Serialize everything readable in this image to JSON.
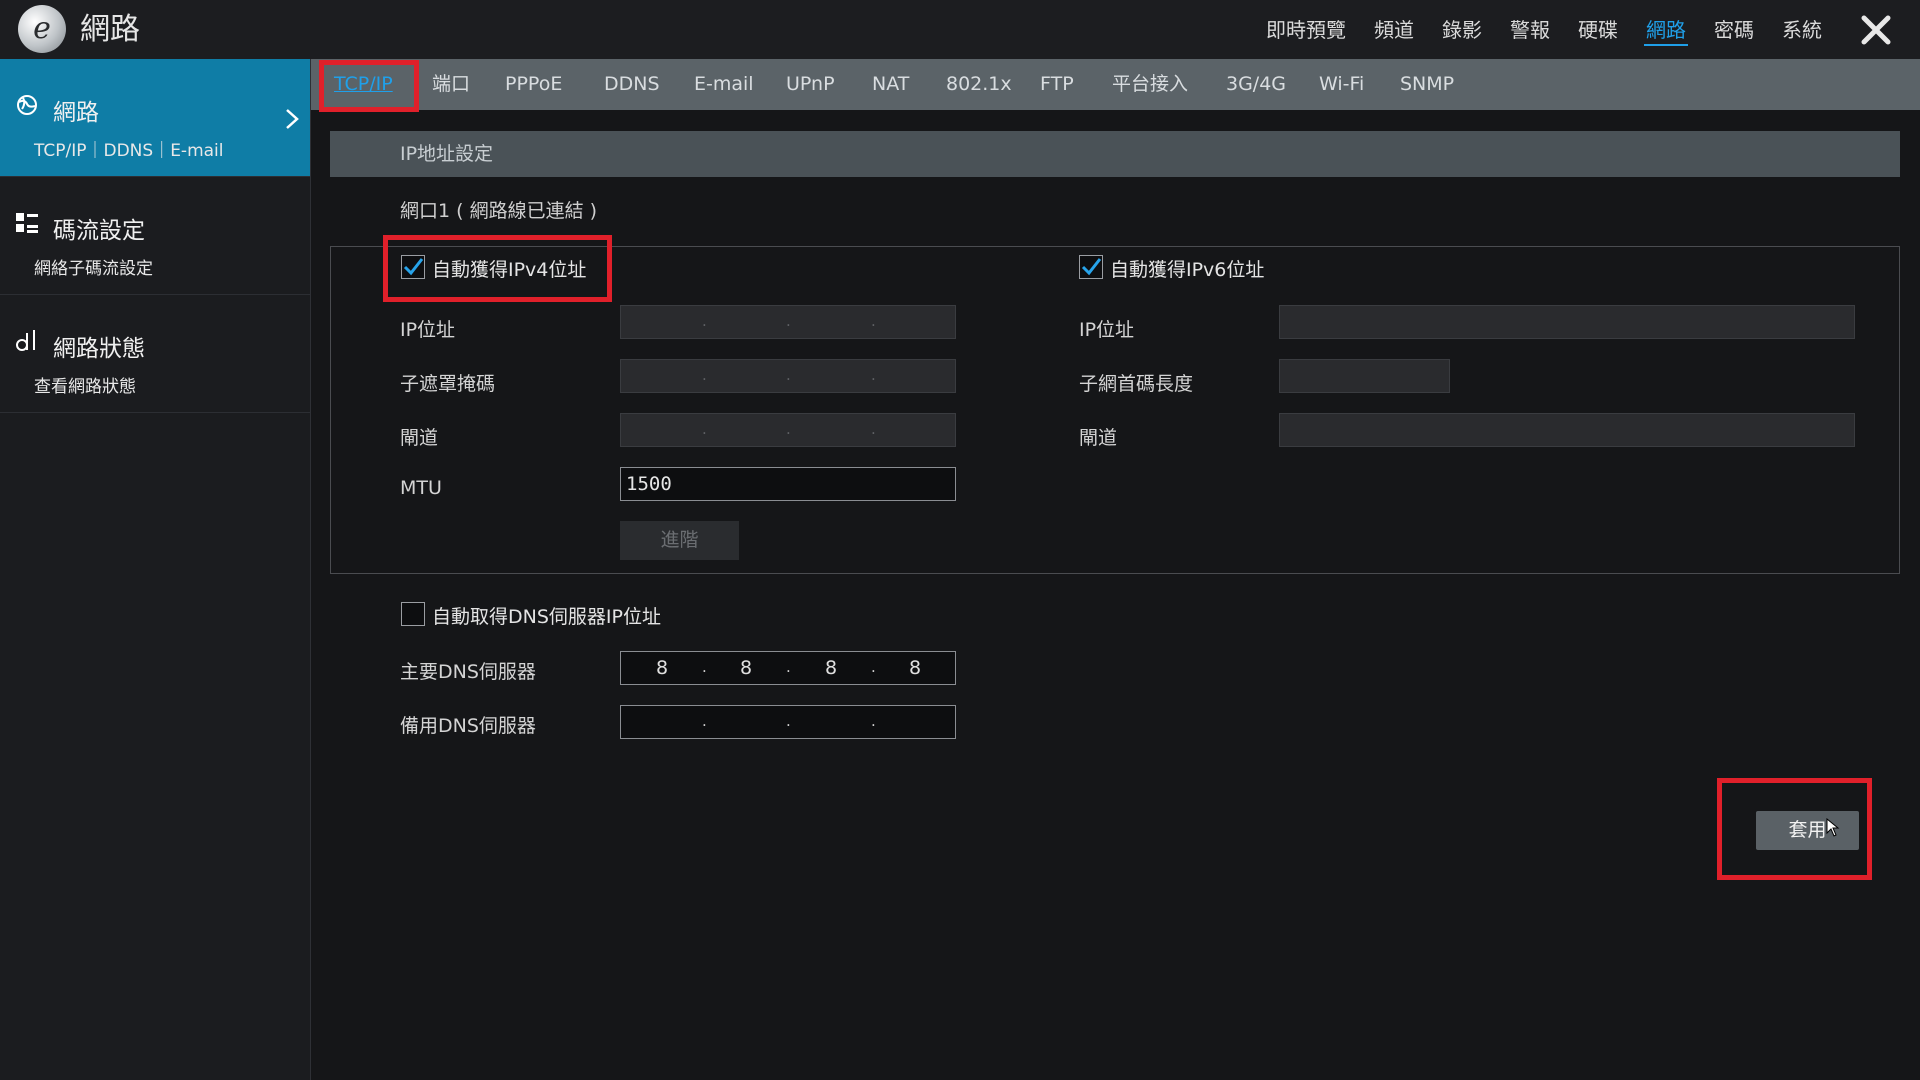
{
  "app": {
    "title": "網路",
    "logo_letter": "e",
    "close_icon": "close-icon"
  },
  "top_nav": {
    "items": [
      "即時預覽",
      "頻道",
      "錄影",
      "警報",
      "硬碟",
      "網路",
      "密碼",
      "系統"
    ],
    "active": "網路"
  },
  "sidebar": {
    "items": [
      {
        "title": "網路",
        "subtitle": "TCP/IP｜DDNS｜E-mail",
        "icon": "globe-icon",
        "active": true
      },
      {
        "title": "碼流設定",
        "subtitle": "網絡子碼流設定",
        "icon": "grid-icon",
        "active": false
      },
      {
        "title": "網路狀態",
        "subtitle": "查看網路狀態",
        "icon": "signal-icon",
        "active": false
      }
    ]
  },
  "subtabs": {
    "items": [
      "TCP/IP",
      "端口",
      "PPPoE",
      "DDNS",
      "E-mail",
      "UPnP",
      "NAT",
      "802.1x",
      "FTP",
      "平台接入",
      "3G/4G",
      "Wi-Fi",
      "SNMP"
    ],
    "active": "TCP/IP"
  },
  "section": {
    "title": "IP地址設定",
    "port_status": "網口1 ( 網路線已連結 )"
  },
  "ipv4": {
    "auto_label": "自動獲得IPv4位址",
    "auto_checked": true,
    "ip_label": "IP位址",
    "mask_label": "子遮罩掩碼",
    "gateway_label": "閘道",
    "mtu_label": "MTU",
    "mtu_value": "1500",
    "advanced_button": "進階"
  },
  "ipv6": {
    "auto_label": "自動獲得IPv6位址",
    "auto_checked": true,
    "ip_label": "IP位址",
    "prefix_label": "子網首碼長度",
    "gateway_label": "閘道"
  },
  "dns": {
    "auto_label": "自動取得DNS伺服器IP位址",
    "auto_checked": false,
    "primary_label": "主要DNS伺服器",
    "primary_octets": [
      "8",
      "8",
      "8",
      "8"
    ],
    "secondary_label": "備用DNS伺服器",
    "secondary_octets": [
      "",
      "",
      "",
      ""
    ]
  },
  "apply_button": "套用",
  "colors": {
    "accent": "#1f9fe8",
    "sidebar_active": "#0f7da6",
    "highlight": "#e0202a",
    "background": "#151618"
  }
}
